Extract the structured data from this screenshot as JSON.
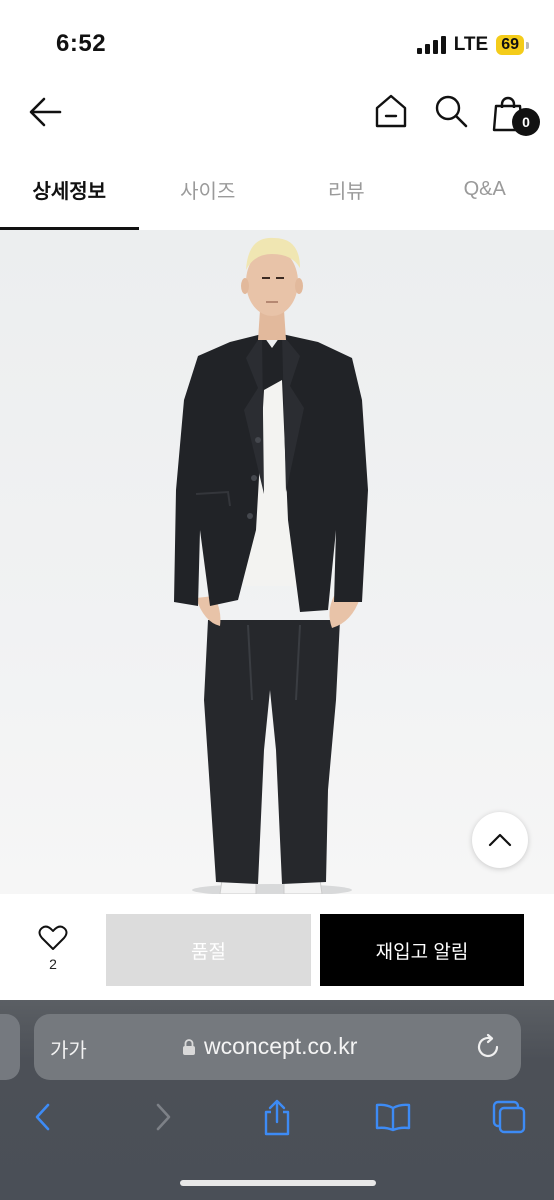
{
  "status_bar": {
    "time": "6:52",
    "network": "LTE",
    "battery": "69"
  },
  "header": {
    "back_icon": "arrow-left-icon",
    "home_icon": "home-icon",
    "search_icon": "search-icon",
    "cart_icon": "shopping-bag-icon",
    "cart_count": "0"
  },
  "tabs": [
    {
      "label": "상세정보",
      "active": true
    },
    {
      "label": "사이즈",
      "active": false
    },
    {
      "label": "리뷰",
      "active": false
    },
    {
      "label": "Q&A",
      "active": false
    }
  ],
  "product_image": {
    "scroll_top_icon": "chevron-up-icon"
  },
  "action_bar": {
    "like_icon": "heart-icon",
    "like_count": "2",
    "soldout_label": "품절",
    "restock_label": "재입고 알림"
  },
  "browser": {
    "text_size_label": "가가",
    "url": "wconcept.co.kr",
    "lock_icon": "lock-icon",
    "reload_icon": "reload-icon",
    "toolbar_icons": [
      "back-chevron-icon",
      "forward-chevron-icon",
      "share-icon",
      "bookmarks-icon",
      "tabs-icon"
    ]
  },
  "colors": {
    "accent": "#000000",
    "soldout_bg": "#dcdcdc",
    "safari_link": "#3d8bf5",
    "battery": "#f4cc1a"
  }
}
